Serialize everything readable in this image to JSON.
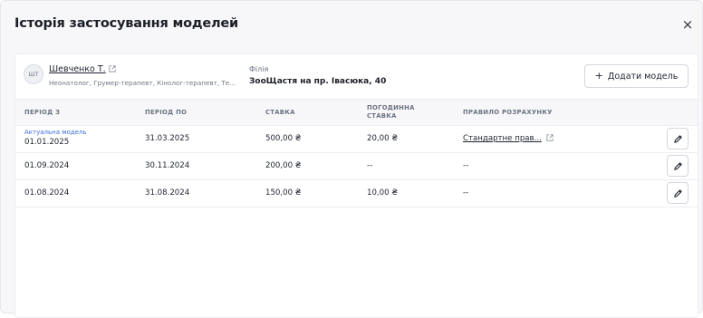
{
  "modal": {
    "title": "Історія застосування моделей",
    "close_label": "×"
  },
  "employee": {
    "initials": "ШТ",
    "name": "Шевченко Т.",
    "roles": "Неонатолог, Грумер-терапевт, Кінолог-терапевт, Те..."
  },
  "branch": {
    "label": "Філія",
    "value": "ЗооЩастя на пр. Івасюка, 40"
  },
  "actions": {
    "add_model_label": "Додати модель"
  },
  "table": {
    "headers": {
      "period_from": "ПЕРІОД З",
      "period_to": "ПЕРІОД ПО",
      "rate": "СТАВКА",
      "hourly_rate_line1": "ПОГОДИННА",
      "hourly_rate_line2": "СТАВКА",
      "calc_rule": "ПРАВИЛО РОЗРАХУНКУ"
    },
    "current_label": "Актуальна модель",
    "rows": [
      {
        "period_from": "01.01.2025",
        "period_to": "31.03.2025",
        "rate": "500,00 ₴",
        "hourly_rate": "20,00 ₴",
        "calc_rule": "Стандартне прав..."
      },
      {
        "period_from": "01.09.2024",
        "period_to": "30.11.2024",
        "rate": "200,00 ₴",
        "hourly_rate": "--",
        "calc_rule": "--"
      },
      {
        "period_from": "01.08.2024",
        "period_to": "31.08.2024",
        "rate": "150,00 ₴",
        "hourly_rate": "10,00 ₴",
        "calc_rule": "--"
      }
    ]
  },
  "icons": {
    "close": "close-icon",
    "external_link": "external-link-icon",
    "plus": "plus-icon",
    "edit": "pencil-icon"
  },
  "colors": {
    "accent": "#3a6fd8",
    "background": "#f7f7fa",
    "card": "#ffffff"
  }
}
